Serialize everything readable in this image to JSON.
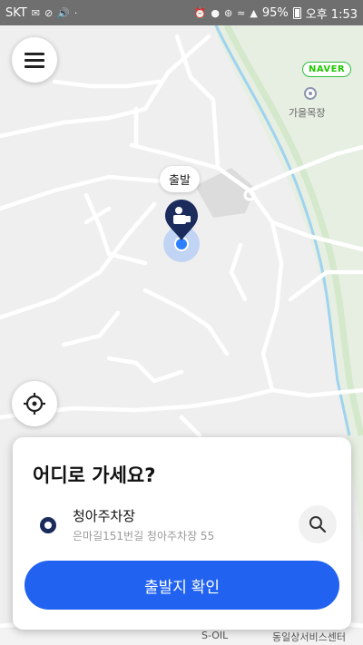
{
  "status_bar": {
    "carrier": "SKT",
    "battery": "95%",
    "time": "오후 1:53"
  },
  "map": {
    "brand": "NAVER",
    "poi_name": "가을목장",
    "departure_tag": "출발",
    "bottom_labels": [
      "S-OIL",
      "동일상서비스센터"
    ]
  },
  "card": {
    "title": "어디로 가세요?",
    "destination_name": "청아주차장",
    "destination_address": "은마길151번길 청아주차장 55",
    "confirm_label": "출발지 확인"
  },
  "colors": {
    "accent": "#2163f0",
    "pin": "#1a2b5c",
    "current_location": "#2f80ff",
    "naver_green": "#1ec800"
  },
  "icons": {
    "menu": "hamburger-icon",
    "locate": "crosshair-icon",
    "search": "search-icon",
    "pin": "departure-pin-icon"
  }
}
